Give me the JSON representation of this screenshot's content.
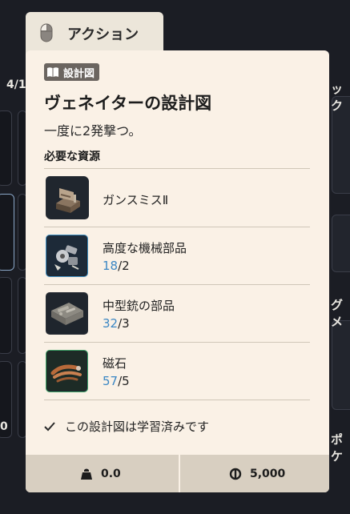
{
  "action_tab": {
    "label": "アクション",
    "icon": "mouse-icon"
  },
  "background": {
    "left_text": "4/1",
    "right_text_1": "ック",
    "right_text_2": "グメ",
    "right_text_3": "ポケ",
    "left_num": "0"
  },
  "card": {
    "badge": {
      "icon": "book-icon",
      "label": "設計図"
    },
    "title": "ヴェネイターの設計図",
    "description": "一度に2発撃つ。",
    "requirements_heading": "必要な資源",
    "resources": [
      {
        "name": "ガンスミスⅡ",
        "have": "",
        "need": "",
        "rarity": "none",
        "icon": "gunsmith-bench-icon"
      },
      {
        "name": "高度な機械部品",
        "have": "18",
        "need": "2",
        "rarity": "blue",
        "icon": "mechanical-parts-icon"
      },
      {
        "name": "中型銃の部品",
        "have": "32",
        "need": "3",
        "rarity": "none",
        "icon": "gun-parts-case-icon"
      },
      {
        "name": "磁石",
        "have": "57",
        "need": "5",
        "rarity": "green",
        "icon": "magnet-icon"
      }
    ],
    "learned": {
      "icon": "check-icon",
      "text": "この設計図は学習済みです"
    },
    "footer": {
      "weight": {
        "icon": "weight-icon",
        "value": "0.0"
      },
      "price": {
        "icon": "coin-icon",
        "value": "5,000"
      }
    }
  }
}
